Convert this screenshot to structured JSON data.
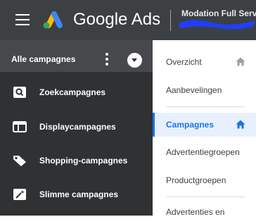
{
  "header": {
    "brand": "Google Ads",
    "account_name": "Modation Full Servic",
    "menu_icon": "hamburger-icon",
    "logo_icon": "google-ads-logo"
  },
  "sidebar": {
    "title": "Alle campagnes",
    "items": [
      {
        "label": "Zoekcampagnes",
        "icon": "search-icon"
      },
      {
        "label": "Displaycampagnes",
        "icon": "display-icon"
      },
      {
        "label": "Shopping-campagnes",
        "icon": "tag-icon"
      },
      {
        "label": "Slimme campagnes",
        "icon": "magic-wand-icon"
      }
    ]
  },
  "subnav": {
    "items": [
      {
        "label": "Overzicht",
        "home_icon": true
      },
      {
        "label": "Aanbevelingen"
      },
      {
        "label": "Campagnes",
        "active": true,
        "home_icon": true
      },
      {
        "label": "Advertentiegroepen"
      },
      {
        "label": "Productgroepen"
      },
      {
        "label": "Advertenties en"
      }
    ]
  },
  "colors": {
    "header_bg": "#3c4043",
    "sidebar_bg": "#2f3133",
    "sidebar_head_bg": "#46484b",
    "accent": "#1a73e8",
    "active_bg": "#e8f0fe"
  }
}
